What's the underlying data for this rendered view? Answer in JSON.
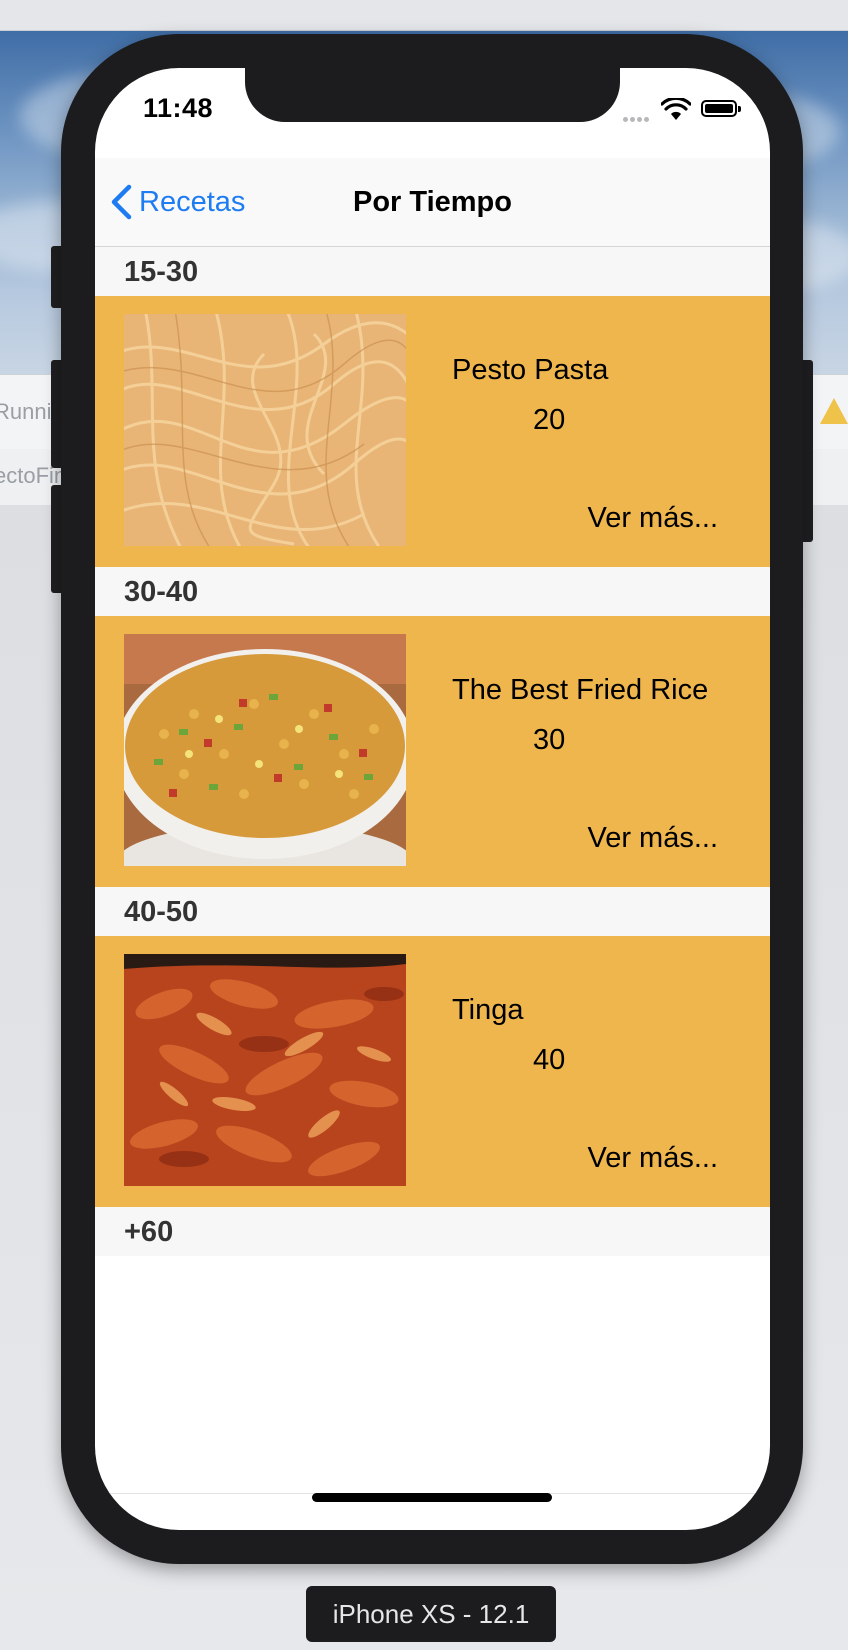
{
  "host": {
    "left_text_1": "Runnin",
    "left_text_2": "ectoFin"
  },
  "status_bar": {
    "time": "11:48"
  },
  "navbar": {
    "back_label": "Recetas",
    "title": "Por Tiempo"
  },
  "sections": [
    {
      "header": "15-30",
      "recipe": {
        "name": "Pesto Pasta",
        "time": "20",
        "more": "Ver más...",
        "image": "pasta-photo"
      }
    },
    {
      "header": "30-40",
      "recipe": {
        "name": "The Best Fried Rice",
        "time": "30",
        "more": "Ver más...",
        "image": "fried-rice-photo"
      }
    },
    {
      "header": "40-50",
      "recipe": {
        "name": "Tinga",
        "time": "40",
        "more": "Ver más...",
        "image": "tinga-photo"
      }
    },
    {
      "header": "+60"
    }
  ],
  "simulator_label": "iPhone XS - 12.1",
  "colors": {
    "row_background": "#efb64e",
    "accent": "#1e7cf2",
    "header_background": "#f7f7f7"
  }
}
